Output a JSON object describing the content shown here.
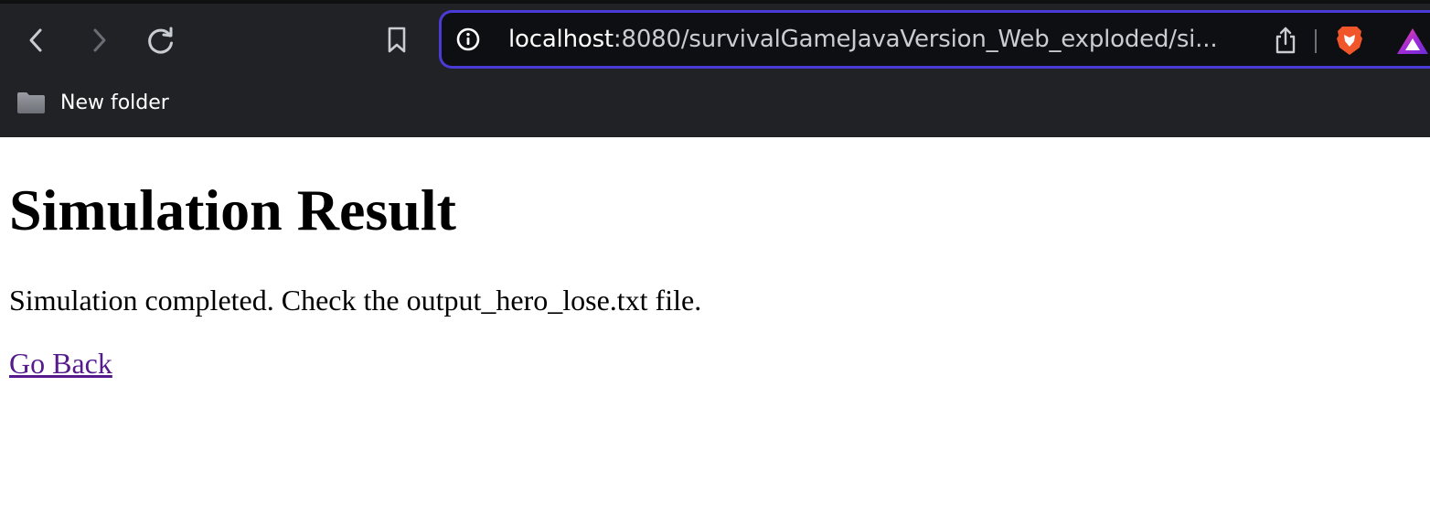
{
  "browser": {
    "url_host": "localhost",
    "url_rest": ":8080/survivalGameJavaVersion_Web_exploded/si...",
    "bookmarks": [
      {
        "label": "New folder"
      }
    ],
    "icons": {
      "back": "chevron-left-icon",
      "forward": "chevron-right-icon",
      "reload": "reload-icon",
      "bookmark": "bookmark-icon",
      "site_info": "info-icon",
      "share": "share-icon",
      "brave": "brave-shields-icon",
      "rewards": "brave-rewards-icon",
      "folder": "folder-icon"
    },
    "colors": {
      "chrome_bg": "#202226",
      "url_bar_bg": "#0e0f12",
      "url_bar_border": "#4b3bd6"
    }
  },
  "page": {
    "title": "Simulation Result",
    "message": "Simulation completed. Check the output_hero_lose.txt file.",
    "link_text": "Go Back",
    "colors": {
      "link": "#551a8b",
      "text": "#000000"
    }
  }
}
